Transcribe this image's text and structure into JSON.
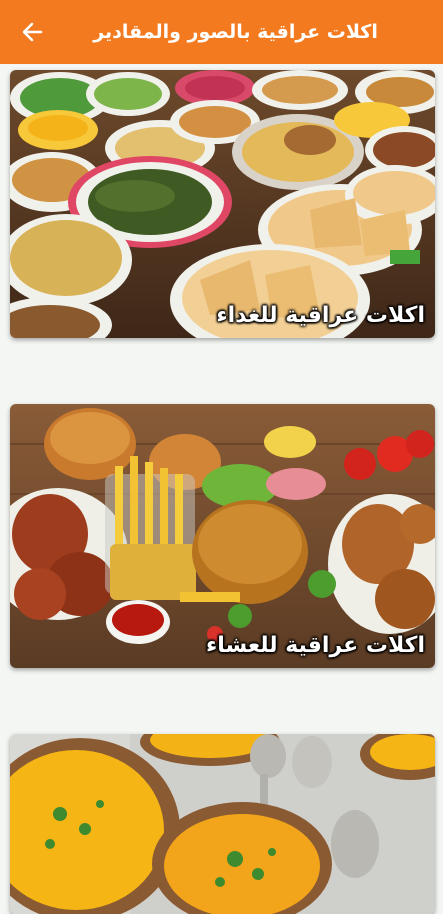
{
  "header": {
    "title": "اكلات عراقية بالصور والمقادير",
    "back_icon": "arrow-back-icon",
    "background_color": "#f37a1f"
  },
  "cards": [
    {
      "label": "اكلات عراقية للغداء",
      "image": "lunch-dishes-photo"
    },
    {
      "label": "اكلات عراقية للعشاء",
      "image": "dinner-dishes-photo"
    },
    {
      "label": "",
      "image": "soup-bowls-photo"
    }
  ]
}
